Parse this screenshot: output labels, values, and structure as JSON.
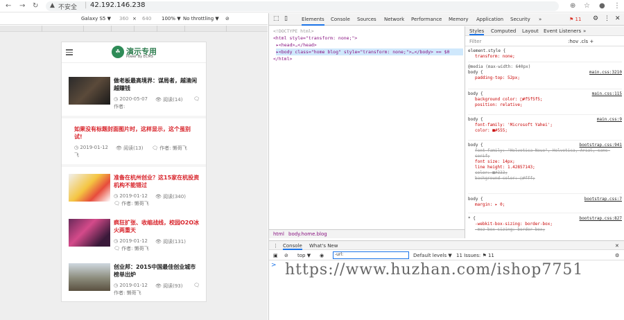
{
  "browser": {
    "address_warning": "不安全",
    "address": "42.192.146.238"
  },
  "device_toolbar": {
    "device": "Galaxy S5 ▼",
    "width": "360",
    "x": "×",
    "height": "640",
    "zoom": "100% ▼",
    "throttle": "No throttling ▼"
  },
  "site": {
    "logo_title": "演示专用",
    "logo_sub": "Power By ECMS",
    "items": [
      {
        "title": "做老板最高境界：谋局者，越清闲越赚钱",
        "date": "◷ 2020-05-07",
        "views": "👁 阅读(14)",
        "author": "作者:",
        "cmt": "🗨"
      },
      {
        "title": "如果没有标题封面图片时，这样显示，这个虽别试!",
        "date": "◷ 2019-01-12",
        "views": "👁 阅读(13)",
        "author": "🗨 作者: 懒哥飞",
        "cmt": ""
      },
      {
        "title": "准备在杭州创业？这15家在杭投资机构不能错过",
        "date": "◷ 2019-01-12",
        "views": "👁 阅读(340)",
        "author": "🗨 作者: 懒哥飞",
        "cmt": ""
      },
      {
        "title": "疯狂扩张、收缩战线，校园O2O冰火两重天",
        "date": "◷ 2019-01-12",
        "views": "👁 阅读(131)",
        "author": "🗨 作者: 懒哥飞",
        "cmt": ""
      },
      {
        "title": "创业邦：2015中国最佳创业城市榜单出炉",
        "date": "◷ 2019-01-12",
        "views": "👁 阅读(93)",
        "author": "作者: 懒哥飞",
        "cmt": "🗨"
      }
    ]
  },
  "devtools": {
    "tabs": [
      "Elements",
      "Console",
      "Sources",
      "Network",
      "Performance",
      "Memory",
      "Application",
      "Security",
      "»"
    ],
    "issues_badge": "⚑ 11",
    "dom": [
      "<!DOCTYPE html>",
      "<html style=\"transform: none;\">",
      "▸<head>…</head>",
      "▸<body class=\"home blog\" style=\"transform: none;\">…</body> == $0",
      "</html>"
    ],
    "breadcrumb": [
      "html",
      "body.home.blog"
    ],
    "styles_tabs": [
      "Styles",
      "Computed",
      "Layout",
      "Event Listeners",
      "»"
    ],
    "filter_placeholder": "Filter",
    "filter_right": ":hov .cls +",
    "rules": [
      {
        "sel": "element.style {",
        "src": "",
        "props": [
          "transform: none;"
        ],
        "strike": []
      },
      {
        "sel": "@media (max-width: 640px)",
        "src": "",
        "props": [],
        "strike": []
      },
      {
        "sel": "body {",
        "src": "main.css:3210",
        "props": [
          "padding-top: 52px;"
        ],
        "strike": []
      },
      {
        "sel": "body {",
        "src": "main.css:115",
        "props": [
          "background color: □#f5f5f5;",
          "position: relative;"
        ],
        "strike": []
      },
      {
        "sel": "body {",
        "src": "main.css:9",
        "props": [
          "font-family: 'Microsoft Yahei';",
          "color: ■#555;"
        ],
        "strike": []
      },
      {
        "sel": "body {",
        "src": "bootstrap.css:941",
        "props": [
          "font size: 14px;",
          "line height: 1.42857143;"
        ],
        "strike": [
          "font-family: \"Helvetica Neue\", Helvetica, Arial, sans-serif;",
          "color: ■#333;",
          "background-color: □#fff;"
        ]
      },
      {
        "sel": "body {",
        "src": "bootstrap.css:7",
        "props": [
          "margin: ▸ 0;"
        ],
        "strike": []
      },
      {
        "sel": "* {",
        "src": "bootstrap.css:827",
        "props": [
          "-webkit-box-sizing: border-box;"
        ],
        "strike": [
          "-moz-box-sizing: border-box;"
        ]
      }
    ],
    "drawer_tabs": [
      "Console",
      "What's New"
    ],
    "console_context": "top ▼",
    "console_filter": "-url:",
    "levels": "Default levels ▼",
    "issues_text": "11 Issues: ⚑ 11",
    "prompt": ">"
  },
  "watermark": "https://www.huzhan.com/ishop7751"
}
